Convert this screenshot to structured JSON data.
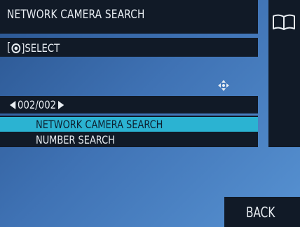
{
  "header": {
    "title": "NETWORK CAMERA SEARCH",
    "bracket_open": "[",
    "select_label": "]SELECT"
  },
  "icons": {
    "manual": "book-icon",
    "dial": "dial-icon",
    "navigation": "four-way-arrow-icon"
  },
  "pager": {
    "text": "002/002"
  },
  "menu": {
    "items": [
      {
        "label": "NETWORK CAMERA SEARCH",
        "selected": true
      },
      {
        "label": "NUMBER SEARCH",
        "selected": false
      }
    ]
  },
  "footer": {
    "back_label": "BACK"
  },
  "colors": {
    "panel": "#111a27",
    "highlight": "#2bb3d2",
    "background": "#3f72b4",
    "text": "#e8edf2"
  }
}
